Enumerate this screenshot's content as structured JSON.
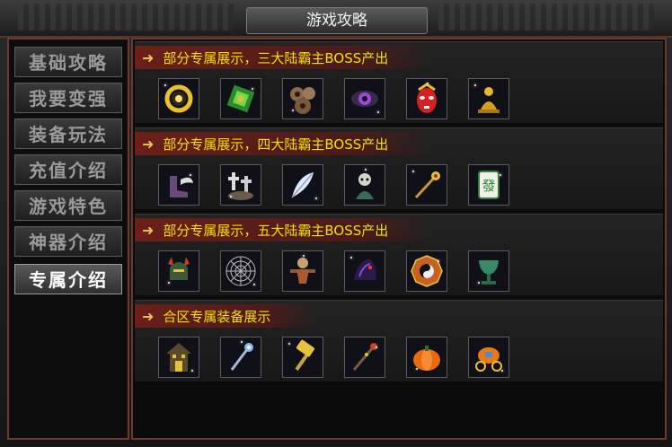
{
  "window": {
    "title": "游戏攻略"
  },
  "sidebar": {
    "items": [
      {
        "label": "基础攻略",
        "active": false
      },
      {
        "label": "我要变强",
        "active": false
      },
      {
        "label": "装备玩法",
        "active": false
      },
      {
        "label": "充值介绍",
        "active": false
      },
      {
        "label": "游戏特色",
        "active": false
      },
      {
        "label": "神器介绍",
        "active": false
      },
      {
        "label": "专属介绍",
        "active": true
      }
    ]
  },
  "sections": [
    {
      "title": "部分专属展示，三大陆霸主BOSS产出",
      "items": [
        "gold-ring-icon",
        "jade-scroll-icon",
        "gear-armor-icon",
        "purple-eye-icon",
        "red-mask-icon",
        "golden-buddha-icon"
      ]
    },
    {
      "title": "部分专属展示，四大陆霸主BOSS产出",
      "items": [
        "winged-boots-icon",
        "tombstone-cross-icon",
        "white-feather-icon",
        "ghost-spirit-icon",
        "golden-staff-icon",
        "mahjong-tile-icon"
      ]
    },
    {
      "title": "部分专属展示，五大陆霸主BOSS产出",
      "items": [
        "demon-helmet-icon",
        "spider-web-icon",
        "scarecrow-icon",
        "dark-cloak-icon",
        "bagua-compass-icon",
        "green-chalice-icon"
      ]
    },
    {
      "title": "合区专属装备展示",
      "items": [
        "haunted-house-icon",
        "ornate-scepter-icon",
        "golden-hammer-icon",
        "dark-staff-icon",
        "pumpkin-icon",
        "pumpkin-carriage-icon"
      ]
    }
  ],
  "mahjong_char": "發",
  "colors": {
    "banner_text": "#f6e000",
    "frame_border": "#6a3a2a",
    "active_menu_text": "#ffffff"
  }
}
